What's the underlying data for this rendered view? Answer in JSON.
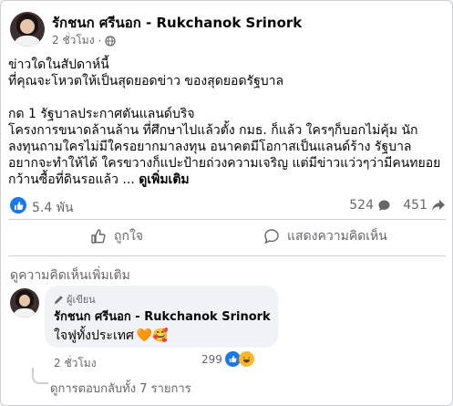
{
  "post": {
    "author": "รักชนก ศรีนอก - Rukchanok Srinork",
    "time": "2 ชั่วโมง",
    "privacy_icon": "globe-icon",
    "headline_1": "ข่าวใดในสัปดาห์นี้",
    "headline_2": "ที่คุณจะโหวตให้เป็นสุดยอดข่าว ของสุดยอดรัฐบาล",
    "body_1": "กด 1 รัฐบาลประกาศตันแลนด์บริจ",
    "body_2": "โครงการขนาดล้านล้าน ที่ศึกษาไปแล้วตั้ง กมธ. ก็แล้ว ใครๆก็บอกไม่คุ้ม นัก",
    "body_3": "ลงทุนถามใครไม่มีใครอยากมาลงทุน อนาคตมีโอกาสเป็นแลนด์ร้าง รัฐบาล",
    "body_4": "อยากจะทำให้ได้ ใครขวางก็แปะป้ายถ่วงความเจริญ แต่มีข่าวแว่วๆว่ามีคนทยอย",
    "body_5": "กว้านซื้อที่ดินรอแล้ว ...",
    "see_more": "ดูเพิ่มเติม"
  },
  "stats": {
    "likes": "5.4 พัน",
    "comments": "524",
    "shares": "451"
  },
  "actions": {
    "like_label": "ถูกใจ",
    "comment_label": "แสดงความคิดเห็น"
  },
  "comments": {
    "more_label": "ดูความคิดเห็นเพิ่มเติม",
    "top": {
      "badge": "ผู้เขียน",
      "author": "รักชนก ศรีนอก - Rukchanok Srinork",
      "text": "ใจฟูทั้งประเทศ",
      "emojis": "🧡🥰",
      "time": "2 ชั่วโมง",
      "reaction_count": "299"
    },
    "replies_label": "ดูการตอบกลับทั้ง 7 รายการ"
  },
  "colors": {
    "accent": "#1877f2",
    "muted": "#65676b",
    "border": "#ced0d4"
  }
}
